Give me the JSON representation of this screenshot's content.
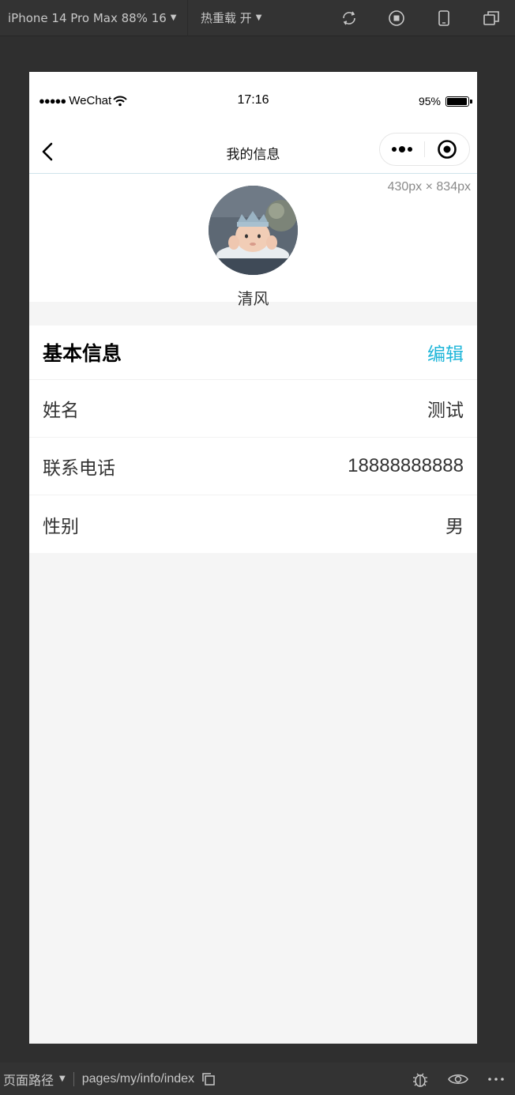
{
  "toolbar": {
    "device_label": "iPhone 14 Pro Max 88% 16",
    "hot_reload_label": "热重载 开"
  },
  "statusbar": {
    "carrier": "WeChat",
    "time": "17:16",
    "battery": "95%",
    "battery_level": 0.95
  },
  "navbar": {
    "title": "我的信息"
  },
  "size_tip": "430px × 834px",
  "profile": {
    "name": "清风"
  },
  "info": {
    "title": "基本信息",
    "edit_label": "编辑",
    "rows": [
      {
        "label": "姓名",
        "value": "测试"
      },
      {
        "label": "联系电话",
        "value": "18888888888"
      },
      {
        "label": "性别",
        "value": "男"
      }
    ]
  },
  "footer": {
    "path_label": "页面路径",
    "path": "pages/my/info/index"
  },
  "colors": {
    "accent": "#1fb6d9",
    "ide_bg": "#2f2f2f",
    "page_bg": "#f5f5f5"
  }
}
